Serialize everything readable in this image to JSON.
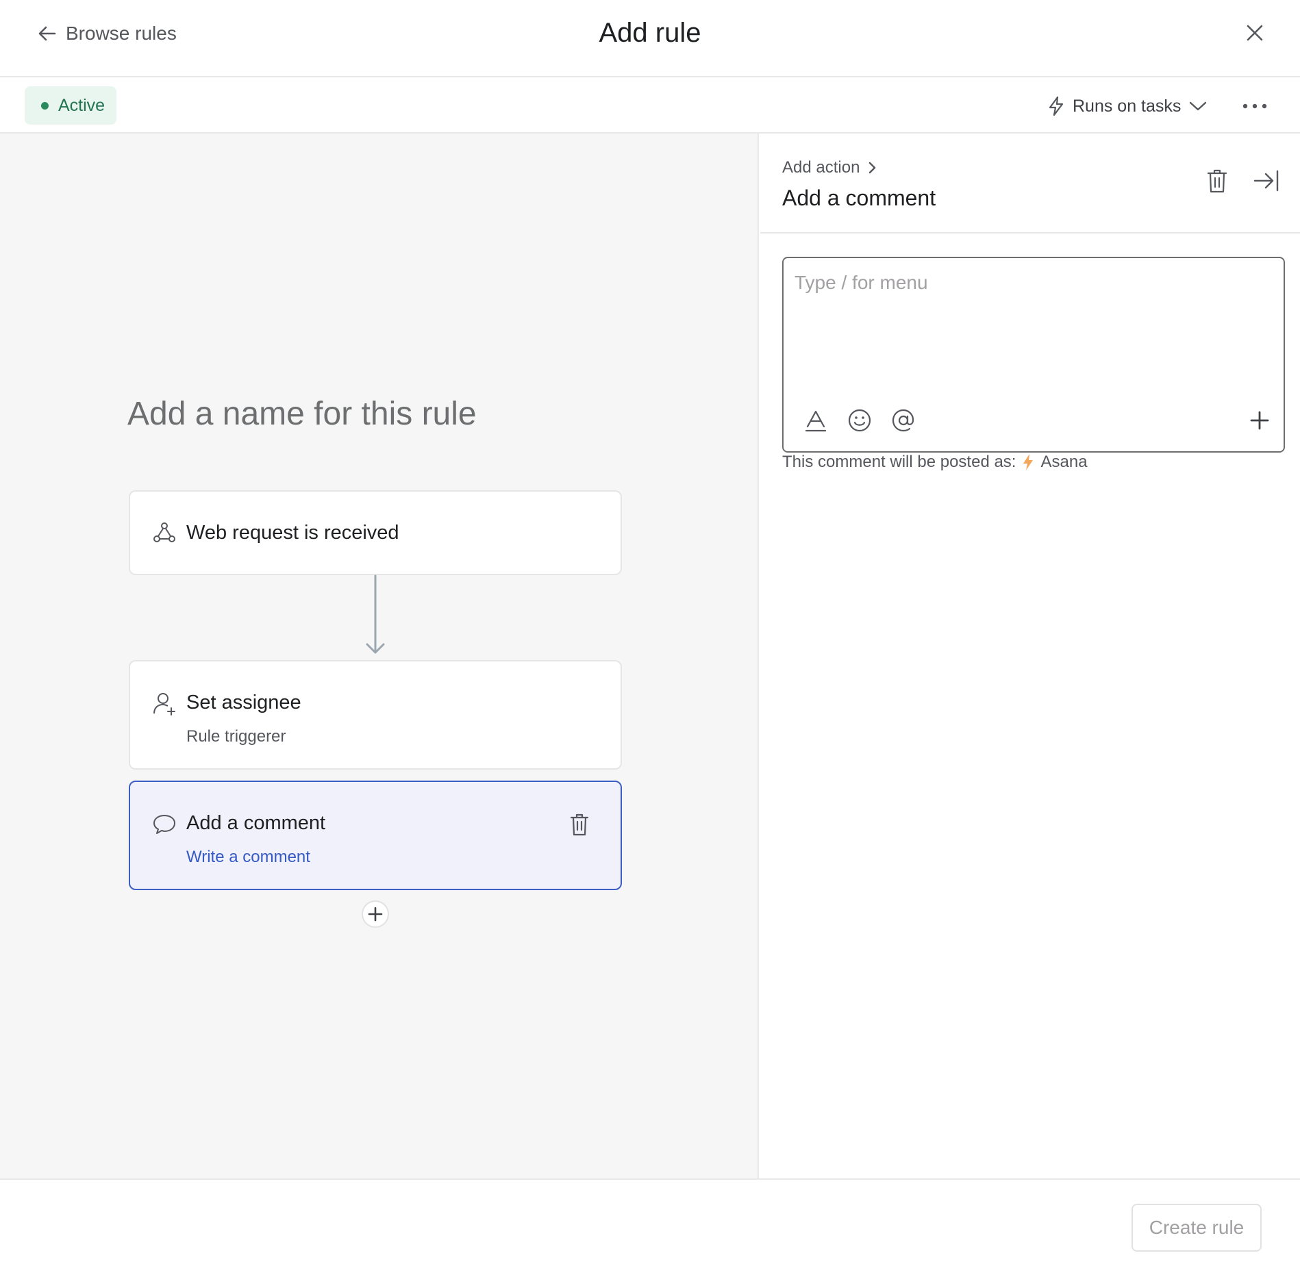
{
  "header": {
    "back_label": "Browse rules",
    "title": "Add rule"
  },
  "toolbar": {
    "status_label": "Active",
    "status_color": "#237552",
    "runs_on_label": "Runs on tasks"
  },
  "canvas": {
    "rule_name_placeholder": "Add a name for this rule",
    "trigger": {
      "title": "Web request is received",
      "icon": "webhook-icon"
    },
    "actions": [
      {
        "title": "Set assignee",
        "subtitle": "Rule triggerer",
        "icon": "user-plus-icon"
      },
      {
        "title": "Add a comment",
        "subtitle": "Write a comment",
        "icon": "comment-icon",
        "selected": true
      }
    ]
  },
  "panel": {
    "breadcrumb": "Add action",
    "title": "Add a comment",
    "editor_placeholder": "Type / for menu",
    "posted_as_label": "This comment will be posted as:",
    "posted_as_name": "Asana"
  },
  "footer": {
    "create_label": "Create rule"
  },
  "colors": {
    "accent": "#3d5ec4",
    "selected_bg": "#f0f1fb",
    "active_bg": "#e9f6f0"
  }
}
